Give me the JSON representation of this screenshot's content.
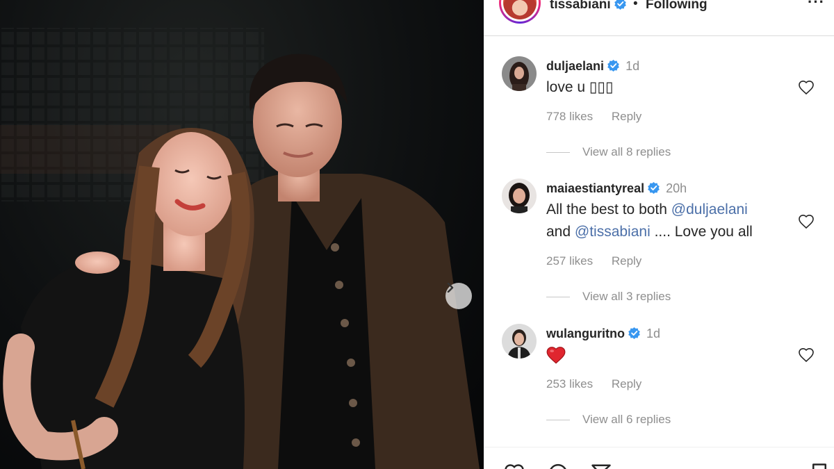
{
  "header": {
    "username": "tissabiani",
    "separator": "•",
    "follow_status": "Following",
    "more": "···"
  },
  "comments": [
    {
      "username": "duljaelani",
      "time": "1d",
      "text": "love u ▯▯▯",
      "likes": "778 likes",
      "reply": "Reply",
      "view_replies": "View all 8 replies"
    },
    {
      "username": "maiaestiantyreal",
      "time": "20h",
      "line1_prefix": "All the best to both ",
      "line1_mention": "@duljaelani",
      "line2_prefix": "and ",
      "line2_mention": "@tissabiani",
      "line2_suffix": " .... Love you all",
      "likes": "257 likes",
      "reply": "Reply",
      "view_replies": "View all 3 replies"
    },
    {
      "username": "wulanguritno",
      "time": "1d",
      "text_icon": "red-heart-emoji",
      "likes": "253 likes",
      "reply": "Reply",
      "view_replies": "View all 6 replies"
    }
  ],
  "icons": {
    "verified_color": "#3897f0",
    "next": "chevron-right-icon",
    "like": "heart-outline-icon",
    "comment": "comment-icon",
    "share": "paper-plane-icon",
    "save": "bookmark-icon"
  },
  "colors": {
    "heart_emoji": "#e0262f",
    "mention": "#4b6fa8"
  }
}
